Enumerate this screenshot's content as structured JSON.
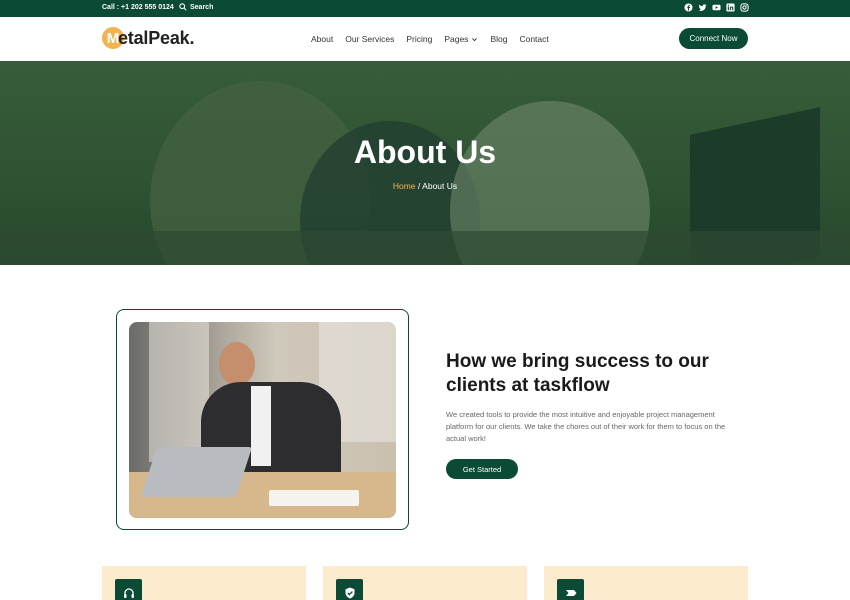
{
  "topbar": {
    "call": "Call : +1 202 555 0124",
    "search": "Search",
    "socials": [
      "facebook-icon",
      "twitter-icon",
      "youtube-icon",
      "linkedin-icon",
      "instagram-icon"
    ]
  },
  "brand": {
    "mark": "M",
    "name": "etalPeak."
  },
  "nav": {
    "items": [
      "About",
      "Our Services",
      "Pricing",
      "Pages",
      "Blog",
      "Contact"
    ],
    "cta": "Connect Now"
  },
  "hero": {
    "title": "About Us",
    "breadcrumb_home": "Home",
    "breadcrumb_sep": " / ",
    "breadcrumb_current": "About Us"
  },
  "about": {
    "heading": "How we bring success to our clients at taskflow",
    "text": "We created tools to provide the most intuitive and enjoyable project management platform for our clients. We take the chores out of their work for them to focus on the actual work!",
    "button": "Get Started"
  },
  "cards": [
    {
      "icon": "headset-icon"
    },
    {
      "icon": "shield-check-icon"
    },
    {
      "icon": "ticket-icon"
    }
  ],
  "colors": {
    "brand": "#0b4a35",
    "accent": "#f4b350",
    "card": "#fcebcc"
  }
}
